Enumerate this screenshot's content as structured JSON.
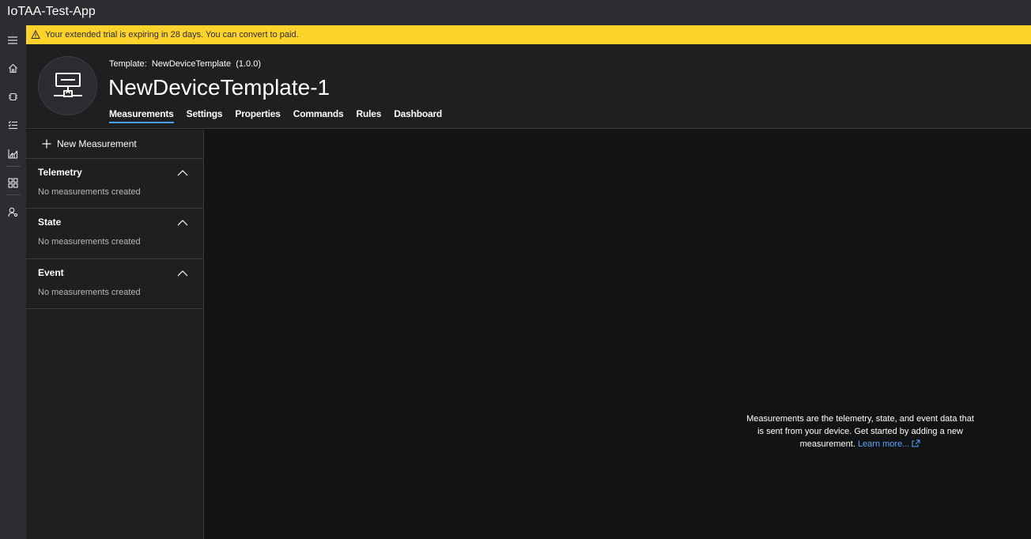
{
  "app": {
    "title": "IoTAA-Test-App"
  },
  "nav": {
    "items": [
      {
        "name": "menu-icon"
      },
      {
        "name": "home-icon"
      },
      {
        "name": "devices-icon"
      },
      {
        "name": "rules-list-icon"
      },
      {
        "name": "analytics-icon"
      },
      {
        "name": "dashboard-grid-icon"
      },
      {
        "name": "administration-icon"
      }
    ]
  },
  "banner": {
    "message": "Your extended trial is expiring in 28 days. You can convert to paid.",
    "color": "#fdd22a"
  },
  "header": {
    "template_label": "Template:",
    "template_name": "NewDeviceTemplate",
    "template_version": "(1.0.0)",
    "title": "NewDeviceTemplate-1",
    "tabs": [
      {
        "label": "Measurements",
        "active": true
      },
      {
        "label": "Settings"
      },
      {
        "label": "Properties"
      },
      {
        "label": "Commands"
      },
      {
        "label": "Rules"
      },
      {
        "label": "Dashboard"
      }
    ]
  },
  "sidepanel": {
    "new_button": "New Measurement",
    "sections": [
      {
        "title": "Telemetry",
        "empty": "No measurements created"
      },
      {
        "title": "State",
        "empty": "No measurements created"
      },
      {
        "title": "Event",
        "empty": "No measurements created"
      }
    ]
  },
  "main": {
    "empty_message": "Measurements are the telemetry, state, and event data that is sent from your device. Get started by adding a new measurement.",
    "learn_more": "Learn more..."
  },
  "colors": {
    "accent": "#4aa0f0",
    "link": "#5aa6ff"
  }
}
